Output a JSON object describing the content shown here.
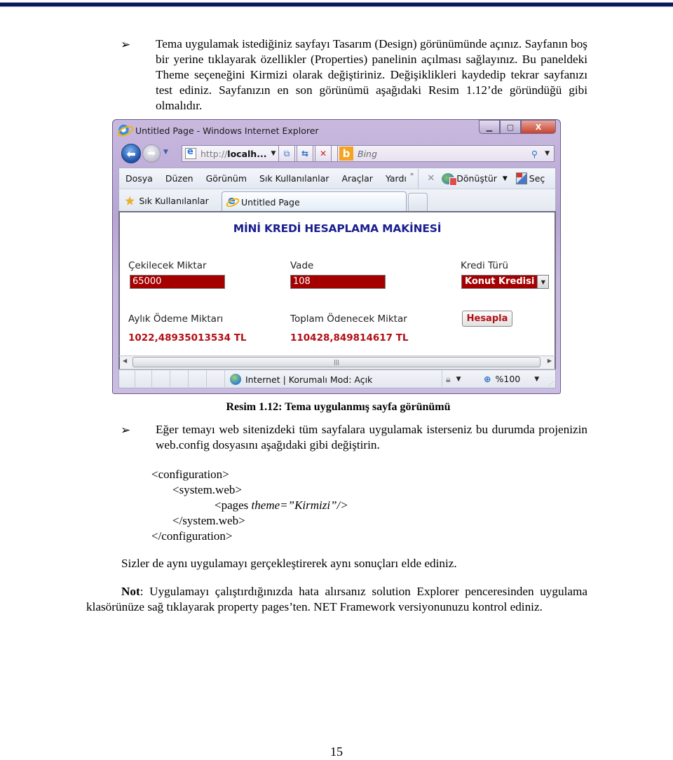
{
  "doc": {
    "bullet_glyph": "➢",
    "para1": "Tema uygulamak istediğiniz sayfayı Tasarım (Design) görünümünde açınız. Sayfanın boş bir yerine tıklayarak özellikler (Properties) panelinin açılması sağlayınız. Bu paneldeki Theme seçeneğini Kirmizi olarak değiştiriniz. Değişiklikleri kaydedip tekrar sayfanızı test ediniz. Sayfanızın en son görünümü aşağıdaki Resim 1.12’de göründüğü gibi olmalıdır.",
    "caption": "Resim 1.12: Tema uygulanmış sayfa görünümü",
    "para2": "Eğer temayı web sitenizdeki tüm sayfalara uygulamak isterseniz bu durumda projenizin web.config dosyasını aşağıdaki gibi değiştirin.",
    "code": {
      "line1": "<configuration>",
      "line2": "<system.web>",
      "line3_prefix": "<pages ",
      "line3_attr": "theme=”Kirmizi”/>",
      "line4": "</system.web>",
      "line5": "</configuration>"
    },
    "para3": "Sizler de aynı uygulamayı gerçekleştirerek aynı sonuçları elde ediniz.",
    "note_label": "Not",
    "note_text": ": Uygulamayı çalıştırdığınızda hata alırsanız solution Explorer penceresinden uygulama klasörünüze sağ tıklayarak property pages’ten. NET Framework versiyonunuzu kontrol ediniz.",
    "page_number": "15"
  },
  "browser": {
    "window_title": "Untitled Page - Windows Internet Explorer",
    "window_buttons": {
      "minimize": "▁",
      "maximize": "▢",
      "close": "X"
    },
    "address_prefix": "http://",
    "address_host": "localh...",
    "search_placeholder": "Bing",
    "menu": [
      "Dosya",
      "Düzen",
      "Görünüm",
      "Sık Kullanılanlar",
      "Araçlar",
      "Yardı"
    ],
    "menu_more": "»",
    "convert_label": "Dönüştür",
    "select_label": "Seç",
    "favorites_label": "Sık Kullanılanlar",
    "tab_title": "Untitled Page",
    "status_zone": "Internet | Korumalı Mod: Açık",
    "zoom_level": "%100"
  },
  "app": {
    "title": "MİNİ KREDİ HESAPLAMA MAKİNESİ",
    "amount_label": "Çekilecek Miktar",
    "amount_value": "65000",
    "term_label": "Vade",
    "term_value": "108",
    "loan_type_label": "Kredi Türü",
    "loan_type_value": "Konut Kredisi",
    "monthly_label": "Aylık Ödeme Miktarı",
    "monthly_value": "1022,48935013534 TL",
    "total_label": "Toplam Ödenecek Miktar",
    "total_value": "110428,849814617 TL",
    "calc_button": "Hesapla",
    "theme_colors": {
      "field_bg": "#a40000",
      "title": "#1a1e8f",
      "result": "#b10f16"
    }
  }
}
